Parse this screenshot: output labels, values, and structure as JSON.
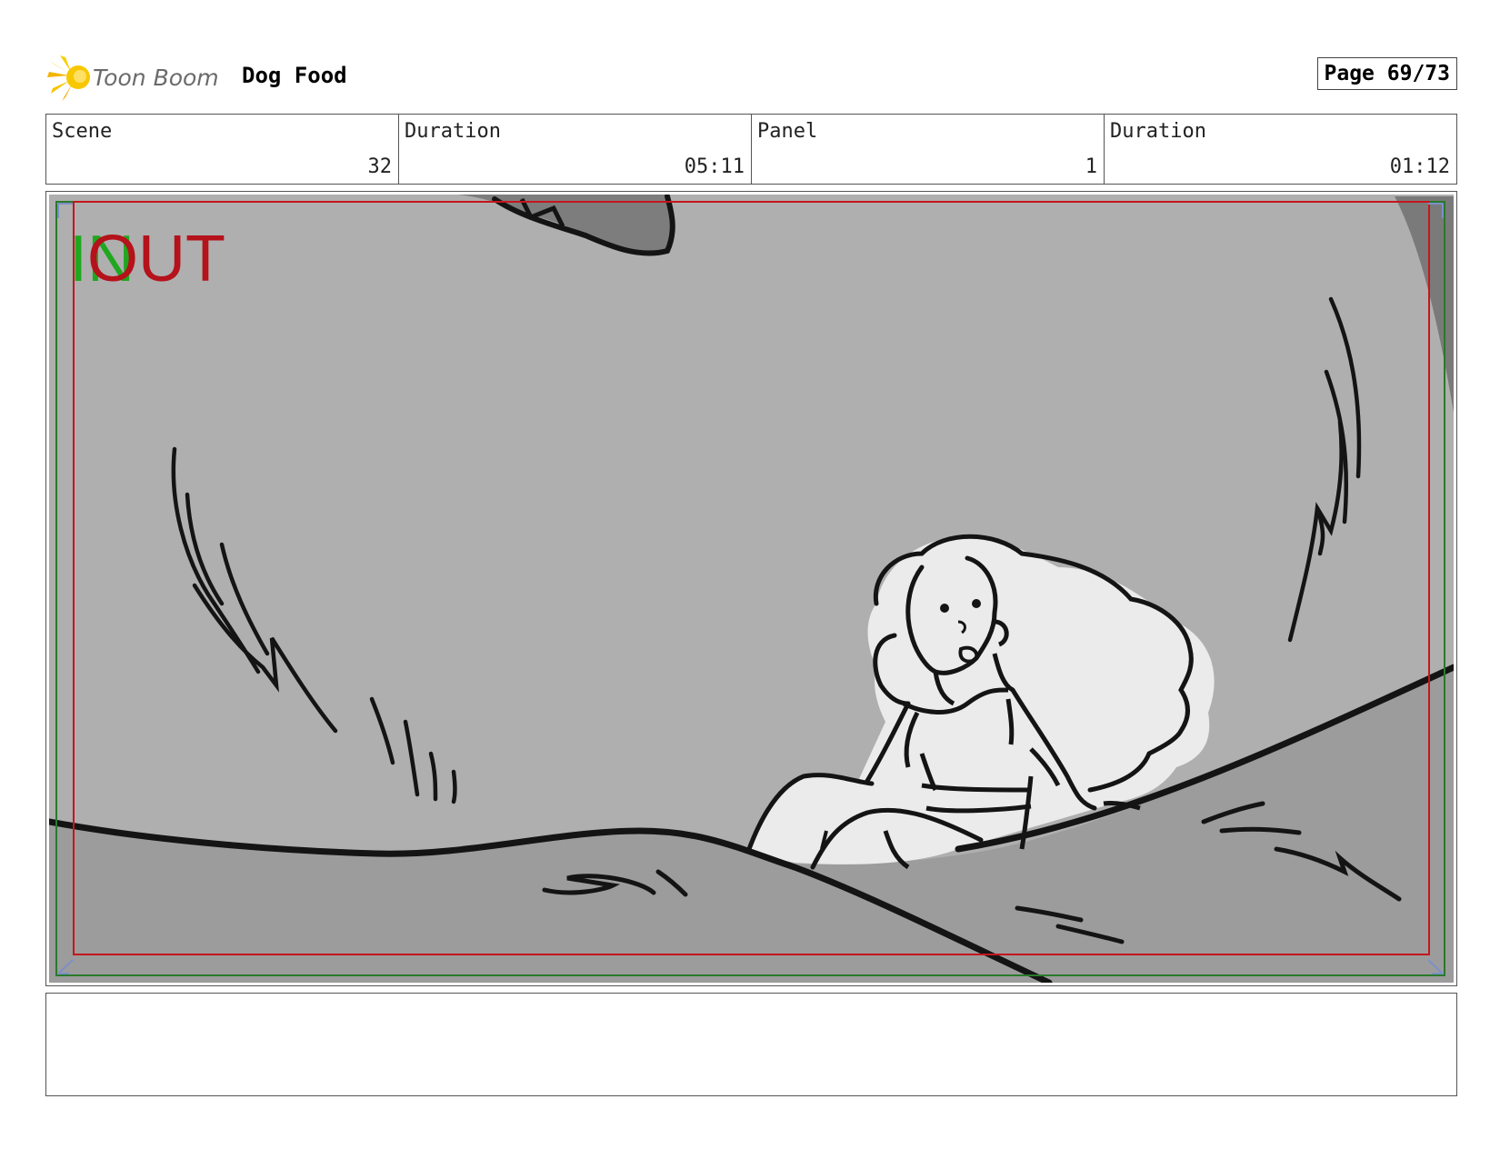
{
  "header": {
    "logo_text": "Toon Boom",
    "project_title": "Dog Food",
    "page_label": "Page 69/73"
  },
  "info": [
    {
      "label": "Scene",
      "value": "32"
    },
    {
      "label": "Duration",
      "value": "05:11"
    },
    {
      "label": "Panel",
      "value": "1"
    },
    {
      "label": "Duration",
      "value": "01:12"
    }
  ],
  "panel": {
    "in_marker": "IN",
    "out_marker": "OUT",
    "colors": {
      "background": "#afafaf",
      "ground": "#9c9c9c",
      "figure": "#ebebeb",
      "line": "#141414",
      "safe_frame_red": "#c4161c",
      "safe_frame_green": "#2a7a2a",
      "in_green": "#1fa81f",
      "out_red": "#b5121b"
    }
  },
  "notes": {
    "text": ""
  }
}
